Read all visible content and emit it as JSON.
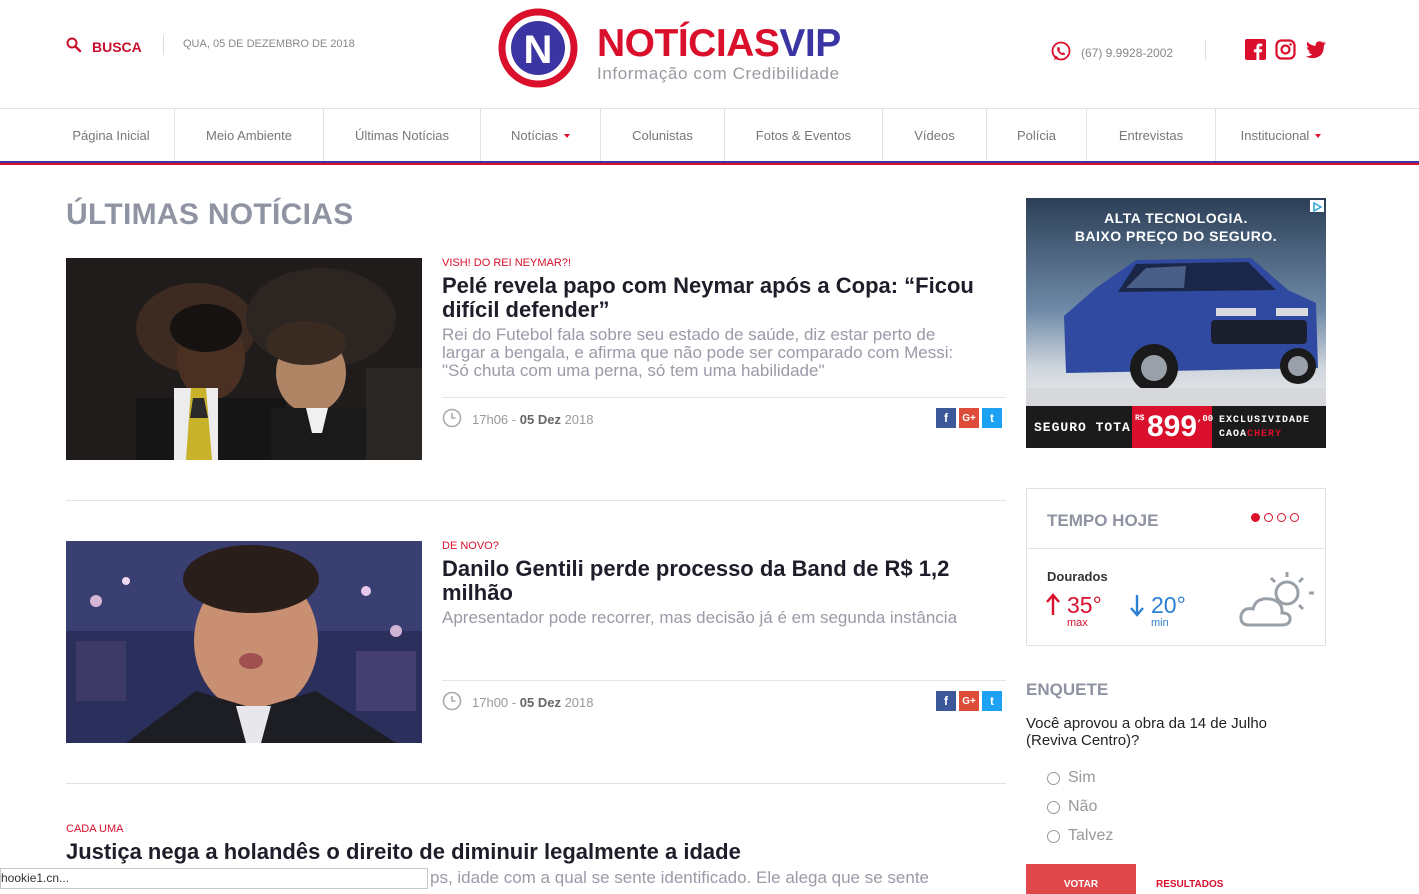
{
  "header": {
    "search_label": "BUSCA",
    "date": "QUA, 05 DE DEZEMBRO DE 2018",
    "logo_letter": "N",
    "logo_part1": "NOTÍCIAS",
    "logo_part2": "VIP",
    "tagline": "Informação com Credibilidade",
    "phone": "(67) 9.9928-2002"
  },
  "nav": {
    "items": [
      {
        "label": "Página Inicial"
      },
      {
        "label": "Meio Ambiente"
      },
      {
        "label": "Últimas Notícias"
      },
      {
        "label": "Notícias"
      },
      {
        "label": "Colunistas"
      },
      {
        "label": "Fotos & Eventos"
      },
      {
        "label": "Vídeos"
      },
      {
        "label": "Polícia"
      },
      {
        "label": "Entrevistas"
      },
      {
        "label": "Institucional"
      }
    ]
  },
  "main": {
    "section_title": "ÚLTIMAS NOTÍCIAS",
    "articles": [
      {
        "kicker": "VISH! DO REI NEYMAR?!",
        "title": "Pelé revela papo com Neymar após a Copa: “Ficou difícil defender”",
        "summary": "Rei do Futebol fala sobre seu estado de saúde, diz estar perto de largar a bengala, e afirma que não pode ser comparado com Messi: \"Só chuta com uma perna, só tem uma habilidade\"",
        "time": "17h06",
        "sep": "-",
        "day": "05 Dez",
        "year": "2018"
      },
      {
        "kicker": "DE NOVO?",
        "title": "Danilo Gentili perde processo da Band de R$ 1,2 milhão",
        "summary": "Apresentador pode recorrer, mas decisão já é em segunda instância",
        "time": "17h00",
        "sep": "-",
        "day": "05 Dez",
        "year": "2018"
      },
      {
        "kicker": "CADA UMA",
        "title": "Justiça nega a holandês o direito de diminuir legalmente a idade",
        "summary": "ps, idade com a qual se sente identificado. Ele alega que se sente"
      }
    ],
    "share_letters": {
      "facebook": "f",
      "google": "G+",
      "twitter": "t"
    }
  },
  "ad": {
    "headline1": "ALTA TECNOLOGIA.",
    "headline2": "BAIXO PREÇO DO SEGURO.",
    "left_text": "SEGURO TOTAL",
    "currency": "R$",
    "price": "899",
    "cents": ",00",
    "right_text1": "EXCLUSIVIDADE",
    "right_text2": "CAOA",
    "right_text3": "CHERY"
  },
  "weather": {
    "title": "TEMPO HOJE",
    "city": "Dourados",
    "max": "35°",
    "max_label": "max",
    "min": "20°",
    "min_label": "min"
  },
  "poll": {
    "title": "ENQUETE",
    "question": "Você aprovou a obra da 14 de Julho (Reviva Centro)?",
    "options": [
      {
        "label": "Sim"
      },
      {
        "label": "Não"
      },
      {
        "label": "Talvez"
      }
    ],
    "vote_label": "VOTAR",
    "results_label": "RESULTADOS"
  },
  "status_text": "hookie1.cn...",
  "colors": {
    "brand_red": "#d90f2b",
    "brand_blue": "#3a35a3",
    "grey_text": "#8f93a2",
    "facebook": "#3b5998",
    "google": "#dd4b39",
    "twitter": "#1da1f2"
  }
}
